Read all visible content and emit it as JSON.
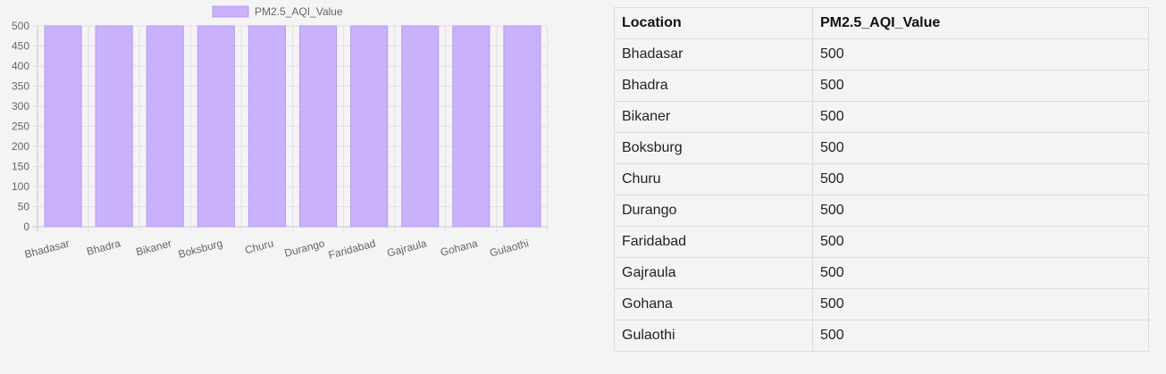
{
  "chart_data": {
    "type": "bar",
    "categories": [
      "Bhadasar",
      "Bhadra",
      "Bikaner",
      "Boksburg",
      "Churu",
      "Durango",
      "Faridabad",
      "Gajraula",
      "Gohana",
      "Gulaothi"
    ],
    "series": [
      {
        "name": "PM2.5_AQI_Value",
        "values": [
          500,
          500,
          500,
          500,
          500,
          500,
          500,
          500,
          500,
          500
        ]
      }
    ],
    "yticks": [
      0,
      50,
      100,
      150,
      200,
      250,
      300,
      350,
      400,
      450,
      500
    ],
    "ylim": [
      0,
      500
    ],
    "grid": true,
    "legend": "top-center",
    "bar_fill": "#c9b1fb",
    "bar_stroke": "#b79af7"
  },
  "table": {
    "headers": [
      "Location",
      "PM2.5_AQI_Value"
    ],
    "rows": [
      [
        "Bhadasar",
        "500"
      ],
      [
        "Bhadra",
        "500"
      ],
      [
        "Bikaner",
        "500"
      ],
      [
        "Boksburg",
        "500"
      ],
      [
        "Churu",
        "500"
      ],
      [
        "Durango",
        "500"
      ],
      [
        "Faridabad",
        "500"
      ],
      [
        "Gajraula",
        "500"
      ],
      [
        "Gohana",
        "500"
      ],
      [
        "Gulaothi",
        "500"
      ]
    ]
  }
}
